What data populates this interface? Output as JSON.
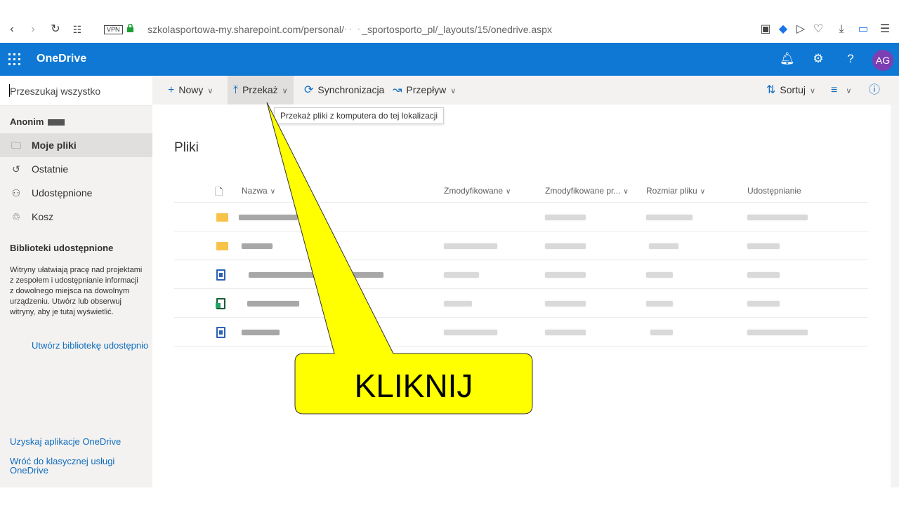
{
  "browser": {
    "vpn_label": "VPN",
    "url_host": "szkolasportowa-my.sharepoint.com",
    "url_path": "/personal/",
    "url_rest": "_sportosporto_pl/_layouts/15/onedrive.aspx"
  },
  "suite": {
    "app_name": "OneDrive",
    "avatar_initials": "AG",
    "accent_color": "#0f78d4"
  },
  "leftnav": {
    "search_placeholder": "Przeszukaj wszystko",
    "user_name": "Anonim",
    "items": [
      {
        "label": "Moje pliki",
        "icon": "folder-icon"
      },
      {
        "label": "Ostatnie",
        "icon": "history-icon"
      },
      {
        "label": "Udostępnione",
        "icon": "people-icon"
      },
      {
        "label": "Kosz",
        "icon": "trash-icon"
      }
    ],
    "libraries_header": "Biblioteki udostępnione",
    "libraries_desc": "Witryny ułatwiają pracę nad projektami z zespołem i udostępnianie informacji z dowolnego miejsca na dowolnym urządzeniu. Utwórz lub obserwuj witryny, aby je tutaj wyświetlić.",
    "create_library": "Utwórz bibliotekę udostępnio",
    "get_app": "Uzyskaj aplikacje OneDrive",
    "classic": "Wróć do klasycznej usługi OneDrive"
  },
  "commandbar": {
    "new_label": "Nowy",
    "upload_label": "Przekaż",
    "sync_label": "Synchronizacja",
    "flow_label": "Przepływ",
    "sort_label": "Sortuj"
  },
  "tooltip": "Przekaż pliki z komputera do tej lokalizacji",
  "page_title": "Pliki",
  "table": {
    "headers": [
      "Nazwa",
      "Zmodyfikowane",
      "Zmodyfikowane pr...",
      "Rozmiar pliku",
      "Udostępnianie"
    ],
    "rows": [
      {
        "type": "folder"
      },
      {
        "type": "folder"
      },
      {
        "type": "word"
      },
      {
        "type": "excel"
      },
      {
        "type": "word"
      }
    ]
  },
  "callout": {
    "text": "KLIKNIJ",
    "fill_color": "#ffff00"
  }
}
